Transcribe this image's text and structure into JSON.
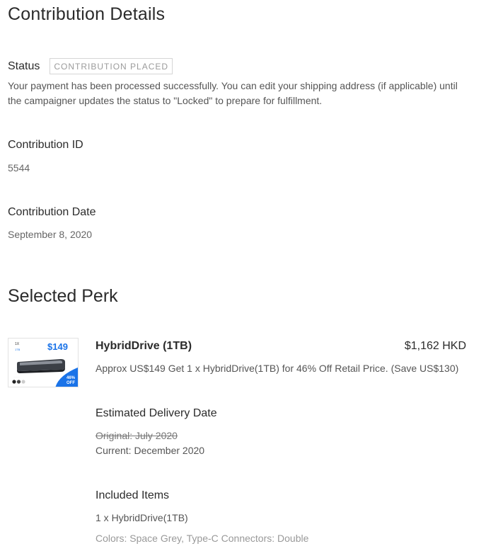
{
  "page": {
    "title": "Contribution Details"
  },
  "status": {
    "label": "Status",
    "badge": "CONTRIBUTION PLACED",
    "description": "Your payment has been processed successfully. You can edit your shipping address (if applicable) until the campaigner updates the status to \"Locked\" to prepare for fulfillment."
  },
  "contribution_id": {
    "label": "Contribution ID",
    "value": "5544"
  },
  "contribution_date": {
    "label": "Contribution Date",
    "value": "September 8, 2020"
  },
  "selected_perk": {
    "section_title": "Selected Perk",
    "image": {
      "qty_badge": "1X",
      "capacity": "1TB",
      "price_text": "$149",
      "discount_line1": "46%",
      "discount_line2": "OFF",
      "accent_color": "#1a73e8"
    },
    "name": "HybridDrive (1TB)",
    "price": "$1,162 HKD",
    "description": "Approx US$149 Get 1 x HybridDrive(1TB) for 46% Off Retail Price. (Save US$130)",
    "delivery": {
      "label": "Estimated Delivery Date",
      "original": "Original: July 2020",
      "current": "Current: December 2020"
    },
    "included": {
      "label": "Included Items",
      "item": "1 x HybridDrive(1TB)",
      "options": "Colors: Space Grey, Type-C Connectors: Double"
    }
  }
}
